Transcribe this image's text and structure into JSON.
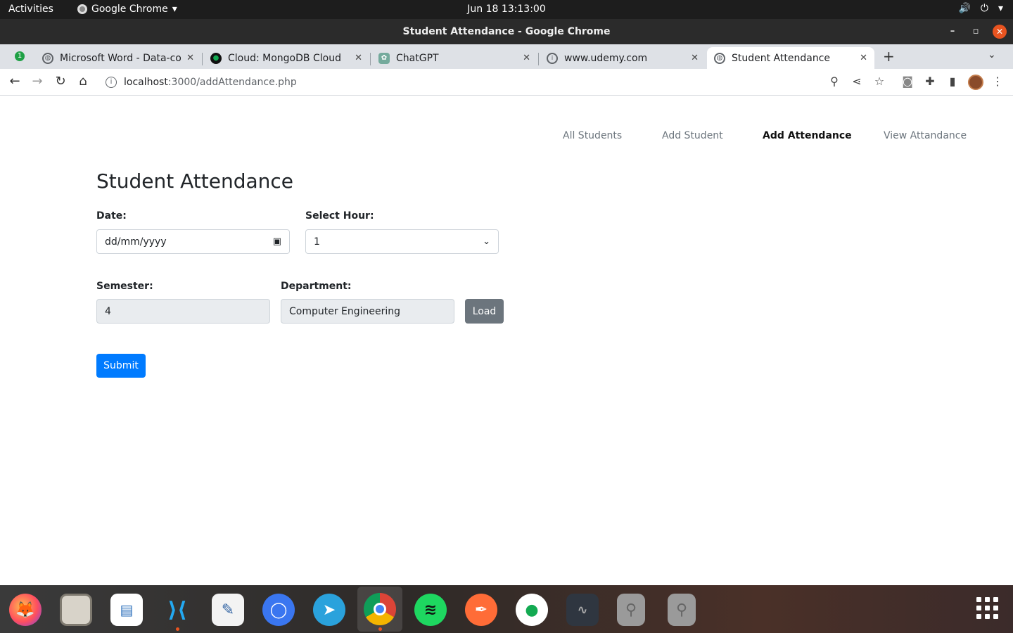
{
  "system_bar": {
    "activities": "Activities",
    "app_menu": "Google Chrome",
    "clock": "Jun 18  13:13:00"
  },
  "window": {
    "title": "Student Attendance - Google Chrome"
  },
  "tabs": [
    {
      "label": "Microsoft Word - Data-cor",
      "icon": "globe-icon"
    },
    {
      "label": "Cloud: MongoDB Cloud",
      "icon": "mongodb-leaf-icon"
    },
    {
      "label": "ChatGPT",
      "icon": "chatgpt-icon"
    },
    {
      "label": "www.udemy.com",
      "icon": "info-icon"
    },
    {
      "label": "Student Attendance",
      "icon": "globe-icon",
      "active": true
    }
  ],
  "tab_group_badge": "1",
  "address": {
    "host": "localhost",
    "path": ":3000/addAttendance.php"
  },
  "nav": {
    "links": [
      {
        "label": "All Students",
        "active": false
      },
      {
        "label": "Add Student",
        "active": false
      },
      {
        "label": "Add Attendance",
        "active": true
      },
      {
        "label": "View Attandance",
        "active": false
      }
    ]
  },
  "form": {
    "heading": "Student Attendance",
    "date_label": "Date:",
    "date_value": "dd/mm/yyyy",
    "hour_label": "Select Hour:",
    "hour_value": "1",
    "semester_label": "Semester:",
    "semester_value": "4",
    "department_label": "Department:",
    "department_value": "Computer Engineering",
    "load_label": "Load",
    "submit_label": "Submit"
  },
  "colors": {
    "primary": "#007bff",
    "secondary": "#6c757d",
    "readonly_bg": "#e9ecef",
    "ubuntu_orange": "#e95420"
  },
  "dock": {
    "apps": [
      "firefox-icon",
      "files-icon",
      "libreoffice-writer-icon",
      "vscode-icon",
      "text-editor-icon",
      "signal-icon",
      "telegram-icon",
      "chrome-icon",
      "spotify-icon",
      "postman-icon",
      "mongodb-compass-icon",
      "system-monitor-icon",
      "usb-drive-icon",
      "usb-drive-icon"
    ]
  }
}
